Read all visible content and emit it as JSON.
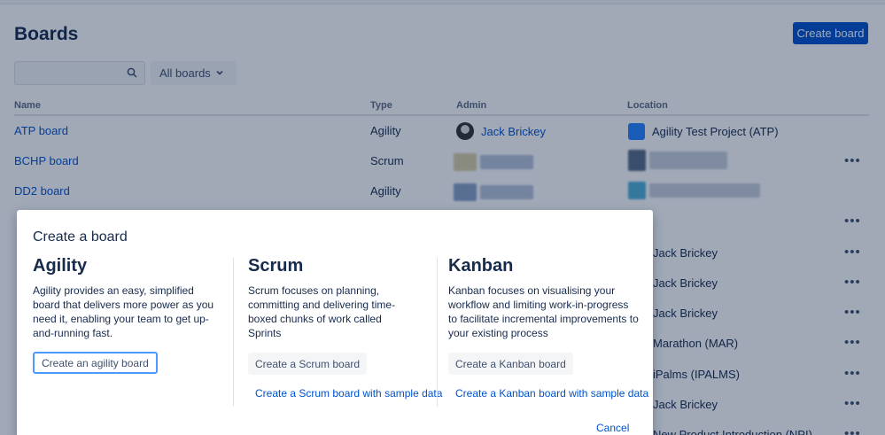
{
  "page": {
    "title": "Boards",
    "create_button": "Create board",
    "filter_label": "All boards",
    "columns": {
      "name": "Name",
      "type": "Type",
      "admin": "Admin",
      "location": "Location"
    },
    "rows": [
      {
        "name": "ATP board",
        "type": "Agility",
        "admin": "Jack Brickey",
        "location": "Agility Test Project (ATP)"
      },
      {
        "name": "BCHP board",
        "type": "Scrum"
      },
      {
        "name": "DD2 board",
        "type": "Agility"
      }
    ],
    "background_locations": [
      "Jack Brickey",
      "Jack Brickey",
      "Jack Brickey",
      "Marathon (MAR)",
      "iPalms (IPALMS)",
      "Jack Brickey",
      "New Product Introduction (NPI)"
    ],
    "more_glyph": "•••"
  },
  "modal": {
    "title": "Create a board",
    "agility": {
      "title": "Agility",
      "description": "Agility provides an easy, simplified board that delivers more power as you need it, enabling your team to get up-and-running fast.",
      "button": "Create an agility board"
    },
    "scrum": {
      "title": "Scrum",
      "description": "Scrum focuses on planning, committing and delivering time-boxed chunks of work called Sprints",
      "button": "Create a Scrum board",
      "sample_link": "Create a Scrum board with sample data"
    },
    "kanban": {
      "title": "Kanban",
      "description": "Kanban focuses on visualising your workflow and limiting work-in-progress to facilitate incremental improvements to your existing process",
      "button": "Create a Kanban board",
      "sample_link": "Create a Kanban board with sample data"
    },
    "cancel": "Cancel"
  },
  "colors": {
    "primary": "#0052cc",
    "overlay": "rgba(9,30,66,0.38)",
    "focus": "#4c9aff"
  },
  "icons": [
    "search-icon",
    "chevron-down-icon",
    "more-icon",
    "avatar",
    "project-icon"
  ]
}
